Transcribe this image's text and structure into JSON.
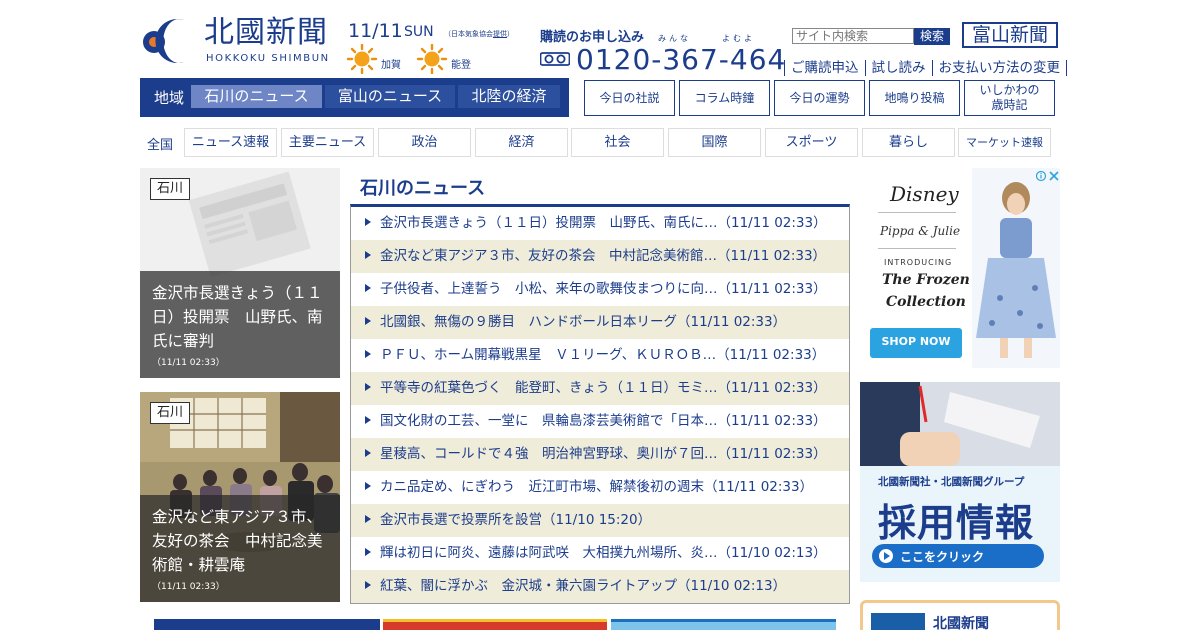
{
  "header": {
    "logo_kanji": "北國新聞",
    "logo_roman": "HOKKOKU SHIMBUN",
    "date": "11/11",
    "weekday": "SUN",
    "weather_credit_prefix": "（日本気象協会",
    "weather_credit_link": "提供",
    "weather_credit_suffix": "）",
    "weather": [
      {
        "area": "加賀",
        "icon": "sun-icon"
      },
      {
        "area": "能登",
        "icon": "sun-icon"
      }
    ],
    "subscribe_title": "購読のお申し込み",
    "ruby_1": "みんな",
    "ruby_2": "よむよ",
    "phone": "0120-367-464",
    "search_placeholder": "サイト内検索",
    "search_button": "検索",
    "toyama_button": "富山新聞",
    "sub_links": [
      "ご購読申込",
      "試し読み",
      "お支払い方法の変更"
    ]
  },
  "region_nav": {
    "label": "地域",
    "tabs": [
      "石川のニュース",
      "富山のニュース",
      "北陸の経済"
    ],
    "active": 0,
    "column_buttons": [
      {
        "lines": [
          "今日の社説"
        ]
      },
      {
        "lines": [
          "コラム時鐘"
        ]
      },
      {
        "lines": [
          "今日の運勢"
        ]
      },
      {
        "lines": [
          "地鳴り投稿"
        ]
      },
      {
        "lines": [
          "いしかわの",
          "歳時記"
        ]
      }
    ]
  },
  "category_nav": {
    "all_label": "全国",
    "tabs": [
      "ニュース速報",
      "主要ニュース",
      "政治",
      "経済",
      "社会",
      "国際",
      "スポーツ",
      "暮らし",
      "マーケット速報"
    ]
  },
  "photos": [
    {
      "tag": "石川",
      "title": "金沢市長選きょう（１１日）投開票　山野氏、南氏に審判",
      "date": "（11/11 02:33）"
    },
    {
      "tag": "石川",
      "title": "金沢など東アジア３市、友好の茶会　中村記念美術館・耕雲庵",
      "date": "（11/11 02:33）"
    }
  ],
  "news": {
    "heading": "石川のニュース",
    "items": [
      "金沢市長選きょう（１１日）投開票　山野氏、南氏に…（11/11 02:33）",
      "金沢など東アジア３市、友好の茶会　中村記念美術館…（11/11 02:33）",
      "子供役者、上達誓う　小松、来年の歌舞伎まつりに向…（11/11 02:33）",
      "北國銀、無傷の９勝目　ハンドボール日本リーグ（11/11 02:33）",
      "ＰＦＵ、ホーム開幕戦黒星　Ｖ１リーグ、ＫＵＲＯＢ…（11/11 02:33）",
      "平等寺の紅葉色づく　能登町、きょう（１１日）モミ…（11/11 02:33）",
      "国文化財の工芸、一堂に　県輪島漆芸美術館で「日本…（11/11 02:33）",
      "星稜高、コールドで４強　明治神宮野球、奥川が７回…（11/11 02:33）",
      "カニ品定め、にぎわう　近江町市場、解禁後初の週末（11/11 02:33）",
      "金沢市長選で投票所を設営（11/10 15:20）",
      "輝は初日に阿炎、遠藤は阿武咲　大相撲九州場所、炎…（11/10 02:13）",
      "紅葉、闇に浮かぶ　金沢城・兼六園ライトアップ（11/10 02:13）"
    ]
  },
  "ads": {
    "disney": {
      "brand": "Disney",
      "sub": "Pippa & Julie",
      "intro": "INTRODUCING",
      "line1": "The Frozen",
      "line2": "Collection",
      "cta": "SHOP NOW"
    },
    "recruit": {
      "sub": "北國新聞社・北國新聞グループ",
      "main": "採用情報",
      "cta": "ここをクリック"
    },
    "third": {
      "title": "北國新聞"
    }
  },
  "colors": {
    "brand_blue": "#1c3d8c",
    "active_tab": "#6f86c6",
    "stripe": "#efecd9"
  }
}
